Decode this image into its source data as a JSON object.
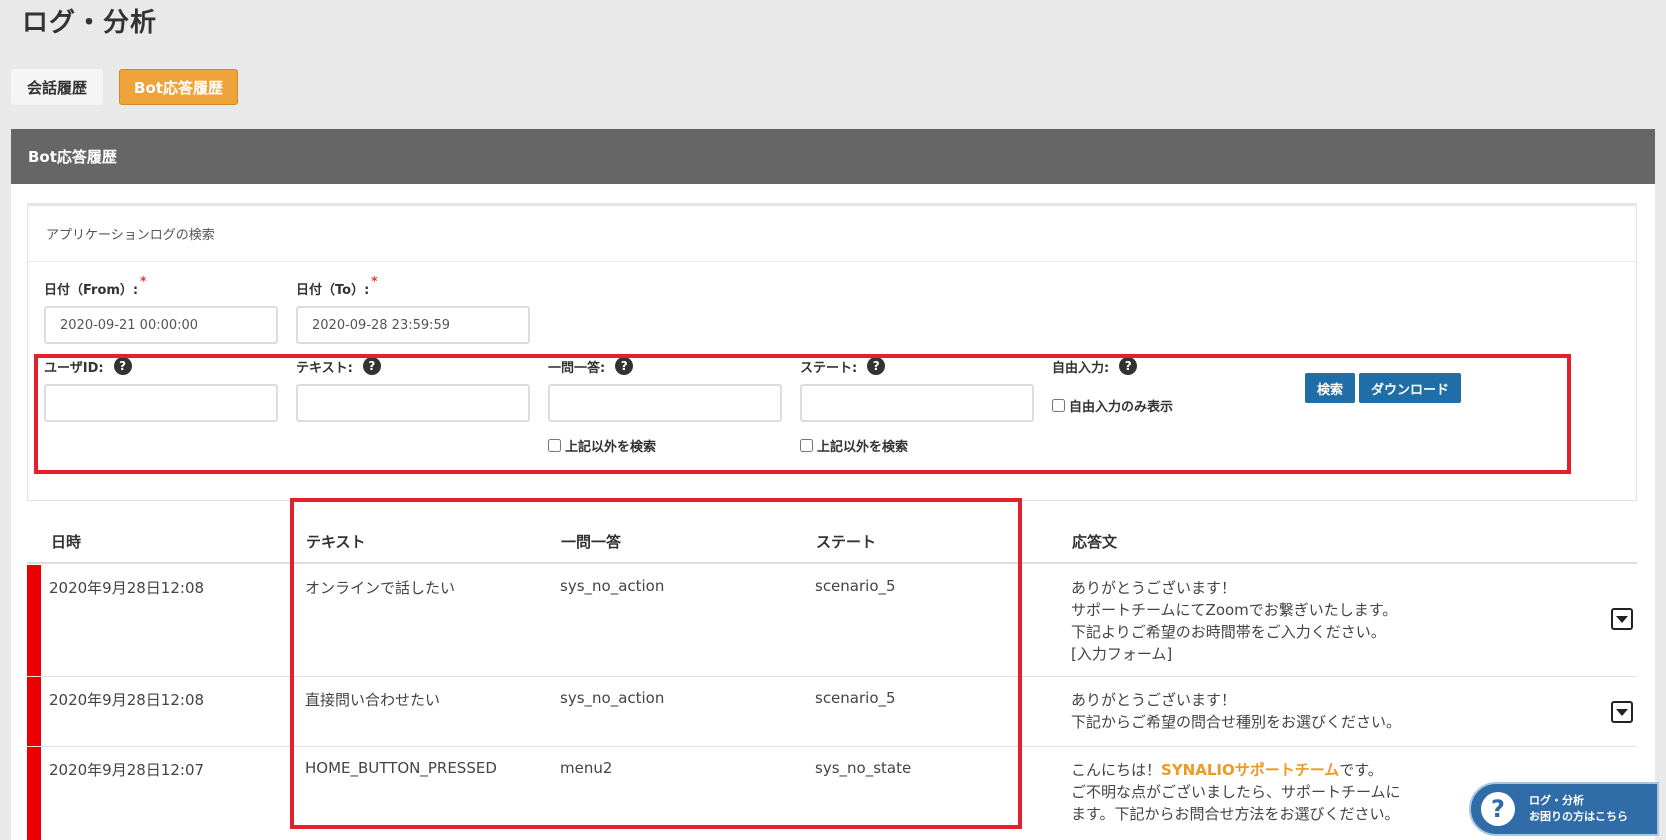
{
  "page": {
    "title": "ログ・分析"
  },
  "tabs": [
    {
      "label": "会話履歴",
      "active": false
    },
    {
      "label": "Bot応答履歴",
      "active": true
    }
  ],
  "panel": {
    "header": "Bot応答履歴"
  },
  "search": {
    "title": "アプリケーションログの検索",
    "date_from": {
      "label": "日付（From）:",
      "required_mark": "*",
      "value": "2020-09-21 00:00:00"
    },
    "date_to": {
      "label": "日付（To）:",
      "required_mark": "*",
      "value": "2020-09-28 23:59:59"
    },
    "user_id": {
      "label": "ユーザID:",
      "value": ""
    },
    "text": {
      "label": "テキスト:",
      "value": ""
    },
    "qa": {
      "label": "一問一答:",
      "value": "",
      "exclude_label": "上記以外を検索"
    },
    "state": {
      "label": "ステート:",
      "value": "",
      "exclude_label": "上記以外を検索"
    },
    "free_input": {
      "label": "自由入力:",
      "only_label": "自由入力のみ表示"
    },
    "search_button": "検索",
    "download_button": "ダウンロード",
    "help_icon_glyph": "?"
  },
  "table": {
    "columns": [
      "日時",
      "テキスト",
      "一問一答",
      "ステート",
      "応答文"
    ],
    "rows": [
      {
        "datetime": "2020年9月28日12:08",
        "text": "オンラインで話したい",
        "qa": "sys_no_action",
        "state": "scenario_5",
        "response": [
          "ありがとうございます！",
          "サポートチームにてZoomでお繋ぎいたします。",
          "下記よりご希望のお時間帯をご入力ください。",
          "[入力フォーム]"
        ]
      },
      {
        "datetime": "2020年9月28日12:08",
        "text": "直接問い合わせたい",
        "qa": "sys_no_action",
        "state": "scenario_5",
        "response": [
          "ありがとうございます！",
          "下記からご希望の問合せ種別をお選びください。"
        ]
      },
      {
        "datetime": "2020年9月28日12:07",
        "text": "HOME_BUTTON_PRESSED",
        "qa": "menu2",
        "state": "sys_no_state",
        "response_prefix": "こんにちは！",
        "response_brand": "SYNALIOサポートチーム",
        "response_suffix": "です。",
        "response": [
          "ご不明な点がございましたら、サポートチームに",
          "ます。下記からお問合せ方法をお選びください。"
        ]
      }
    ]
  },
  "help_widget": {
    "glyph": "?",
    "line1": "ログ・分析",
    "line2": "お困りの方はこちら"
  },
  "colors": {
    "accent": "#eea43a",
    "primary": "#1f6ea8",
    "marker": "#ee0000",
    "highlight": "#e5202a"
  }
}
